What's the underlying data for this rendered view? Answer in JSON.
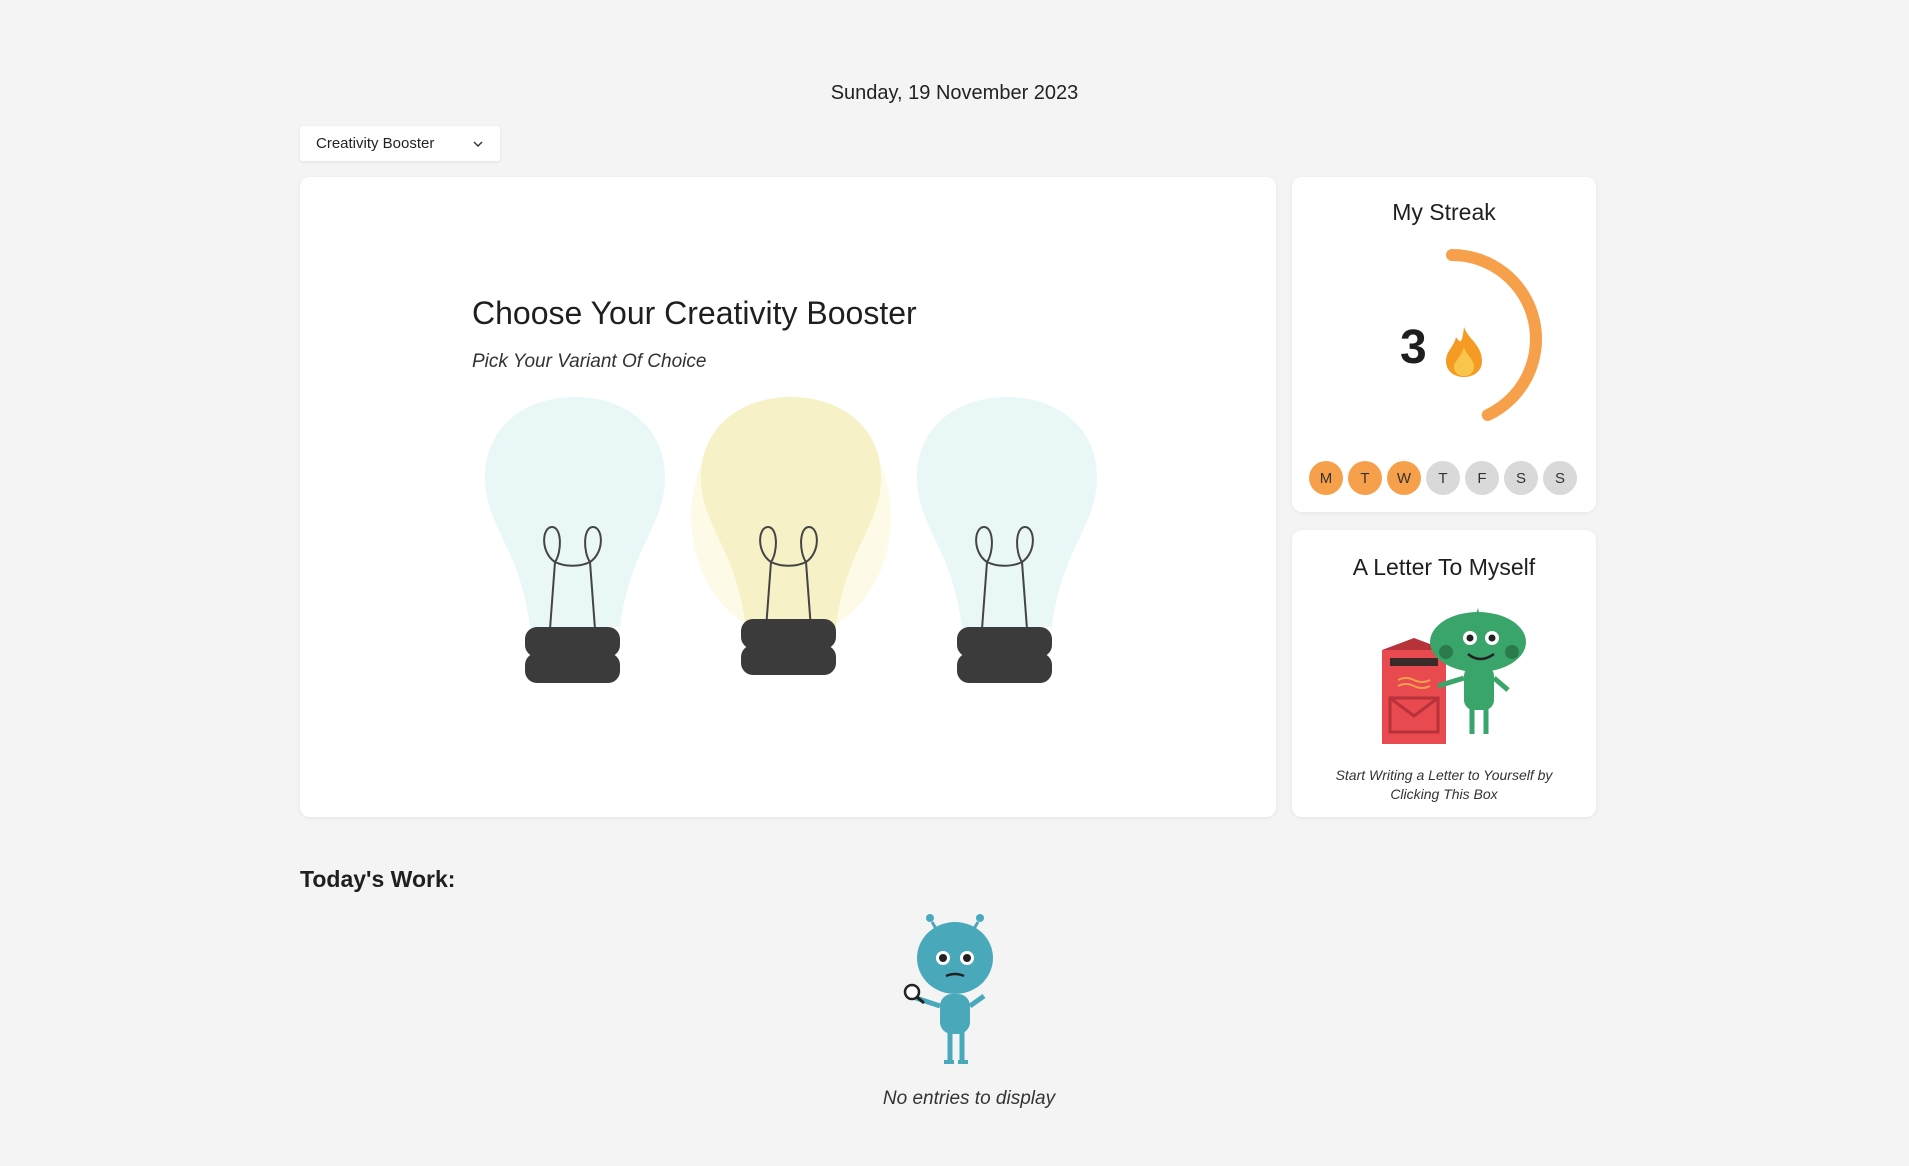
{
  "header": {
    "date": "Sunday, 19 November 2023"
  },
  "variant_select": {
    "selected": "Creativity Booster"
  },
  "booster": {
    "title": "Choose Your Creativity Booster",
    "subtitle": "Pick Your Variant Of Choice",
    "bulbs": [
      {
        "name": "bulb-1",
        "glass_color": "#e9f7f7",
        "lit": false
      },
      {
        "name": "bulb-2",
        "glass_color": "#f6f1c6",
        "lit": true
      },
      {
        "name": "bulb-3",
        "glass_color": "#e9f7f7",
        "lit": false
      }
    ]
  },
  "streak": {
    "title": "My Streak",
    "count": "3",
    "progress": 0.43,
    "accent": "#f7a04b",
    "days": [
      {
        "label": "M",
        "done": true
      },
      {
        "label": "T",
        "done": true
      },
      {
        "label": "W",
        "done": true
      },
      {
        "label": "T",
        "done": false
      },
      {
        "label": "F",
        "done": false
      },
      {
        "label": "S",
        "done": false
      },
      {
        "label": "S",
        "done": false
      }
    ]
  },
  "letter": {
    "title": "A Letter To Myself",
    "text": "Start Writing a Letter to Yourself by Clicking This Box"
  },
  "work": {
    "title": "Today's Work:",
    "empty_text": "No entries to display"
  }
}
